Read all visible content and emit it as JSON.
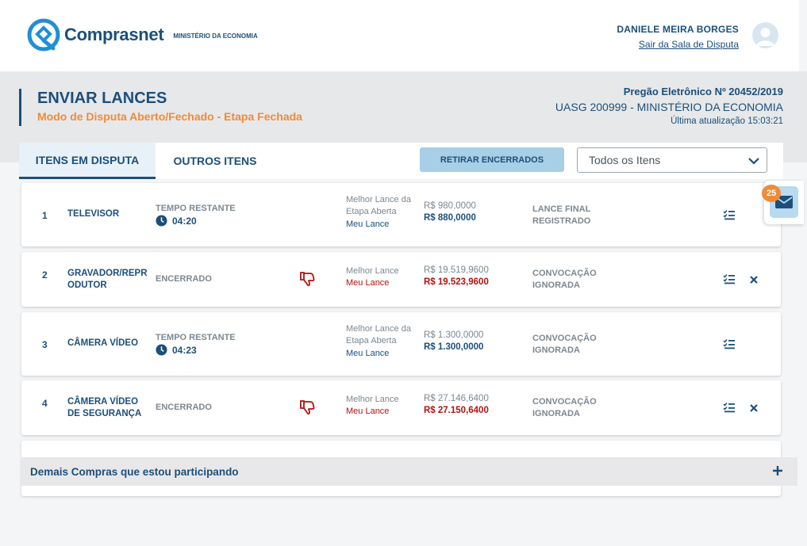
{
  "brand": {
    "name": "Comprasnet",
    "subtitle": "MINISTÉRIO DA ECONOMIA"
  },
  "user": {
    "name": "DANIELE MEIRA BORGES",
    "exit_link": "Sair da Sala de Disputa"
  },
  "page": {
    "title": "ENVIAR LANCES",
    "subtitle": "Modo de Disputa Aberto/Fechado - Etapa Fechada",
    "pregao": "Pregão Eletrônico Nº 20452/2019",
    "uasg": "UASG 200999 - MINISTÉRIO DA ECONOMIA",
    "last_update": "Última atualização 15:03:21"
  },
  "tabs": {
    "active": "ITENS EM DISPUTA",
    "other": "OUTROS ITENS"
  },
  "toolbar": {
    "retirar_label": "RETIRAR ENCERRADOS",
    "filter_value": "Todos os Itens"
  },
  "items": [
    {
      "num": "1",
      "name": "TELEVISOR",
      "time_label": "TEMPO RESTANTE",
      "time": "04:20",
      "best_label": "Melhor Lance da Etapa Aberta",
      "mine_label": "Meu Lance",
      "best_value": "R$ 980,0000",
      "my_value": "R$ 880,0000",
      "state": "LANCE FINAL REGISTRADO"
    },
    {
      "num": "2",
      "name": "GRAVADOR/REPRODUTOR",
      "status": "ENCERRADO",
      "best_label": "Melhor Lance",
      "mine_label": "Meu Lance",
      "best_value": "R$ 19.519,9600",
      "my_value": "R$ 19.523,9600",
      "state": "CONVOCAÇÃO IGNORADA"
    },
    {
      "num": "3",
      "name": "CÂMERA VÍDEO",
      "time_label": "TEMPO RESTANTE",
      "time": "04:23",
      "best_label": "Melhor Lance da Etapa Aberta",
      "mine_label": "Meu Lance",
      "best_value": "R$ 1.300,0000",
      "my_value": "R$ 1.300,0000",
      "state": "CONVOCAÇÃO IGNORADA"
    },
    {
      "num": "4",
      "name": "CÂMERA VÍDEO DE SEGURANÇA",
      "status": "ENCERRADO",
      "best_label": "Melhor Lance",
      "mine_label": "Meu Lance",
      "best_value": "R$ 27.146,6400",
      "my_value": "R$ 27.150,6400",
      "state": "CONVOCAÇÃO IGNORADA"
    }
  ],
  "other_purchases": {
    "label": "Demais Compras que estou participando"
  },
  "messages": {
    "count": "25"
  },
  "colors": {
    "primary": "#1c4f7a",
    "accent": "#f08a38",
    "danger": "#b3120f",
    "button_light": "#a7cfe6"
  },
  "icons": [
    "clock-icon",
    "thumbs-down-icon",
    "checklist-icon",
    "close-icon",
    "mail-icon",
    "plus-icon",
    "chevron-down-icon",
    "user-avatar-icon"
  ]
}
